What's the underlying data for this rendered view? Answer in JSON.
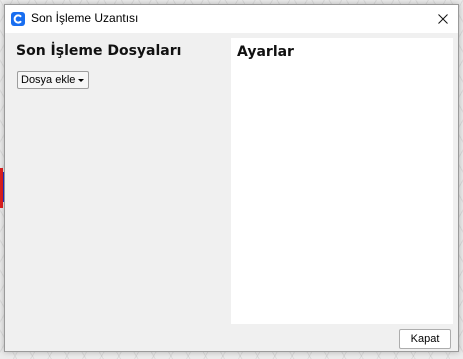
{
  "window": {
    "title": "Son İşleme Uzantısı",
    "app_icon": "cura-icon",
    "accent_color": "#196ef0"
  },
  "left_panel": {
    "title": "Son İşleme Dosyaları",
    "add_file_label": "Dosya ekle"
  },
  "settings_panel": {
    "title": "Ayarlar"
  },
  "footer": {
    "close_label": "Kapat"
  }
}
